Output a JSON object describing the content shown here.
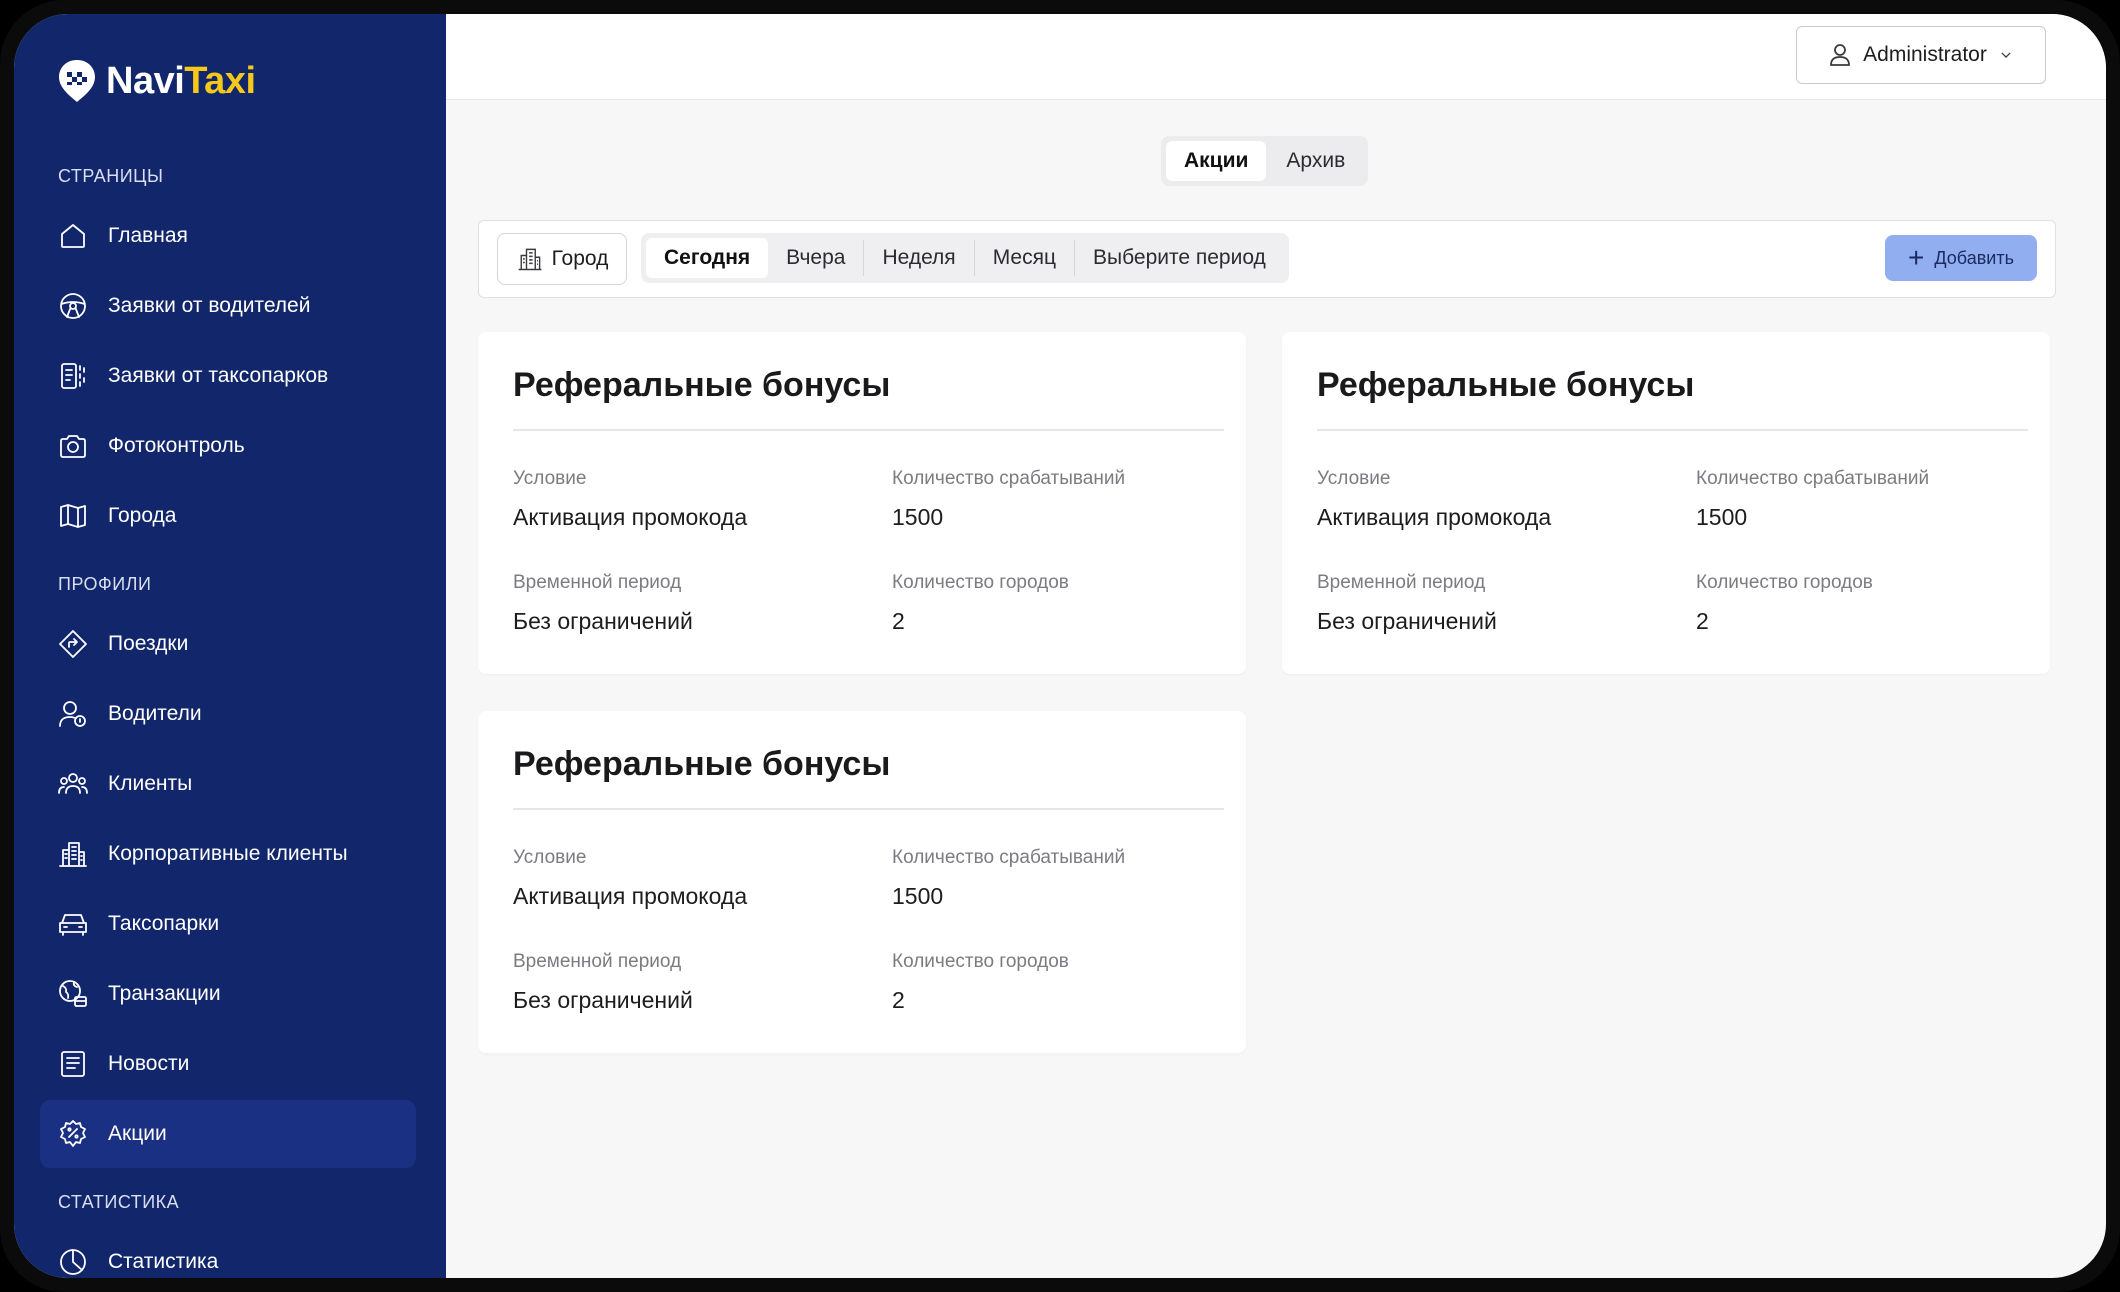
{
  "app": {
    "logo_part1": "Navi",
    "logo_part2": "Taxi"
  },
  "colors": {
    "sidebar_bg": "#12266b",
    "sidebar_active": "#1a3082",
    "logo_accent": "#f6c81a",
    "add_button": "#91aef0"
  },
  "sidebar": {
    "sections": [
      {
        "title": "Страницы",
        "items": [
          {
            "label": "Главная",
            "icon": "home-icon"
          },
          {
            "label": "Заявки от водителей",
            "icon": "steering-wheel-icon"
          },
          {
            "label": "Заявки от таксопарков",
            "icon": "documents-icon"
          },
          {
            "label": "Фотоконтроль",
            "icon": "camera-icon"
          },
          {
            "label": "Города",
            "icon": "map-icon"
          }
        ]
      },
      {
        "title": "Профили",
        "items": [
          {
            "label": "Поездки",
            "icon": "route-icon"
          },
          {
            "label": "Водители",
            "icon": "driver-icon"
          },
          {
            "label": "Клиенты",
            "icon": "users-icon"
          },
          {
            "label": "Корпоративные клиенты",
            "icon": "building-icon"
          },
          {
            "label": "Таксопарки",
            "icon": "car-icon"
          },
          {
            "label": "Транзакции",
            "icon": "transactions-icon"
          },
          {
            "label": "Новости",
            "icon": "news-icon"
          },
          {
            "label": "Акции",
            "icon": "promo-icon",
            "active": true
          }
        ]
      },
      {
        "title": "Статистика",
        "items": [
          {
            "label": "Статистика",
            "icon": "pie-chart-icon"
          }
        ]
      }
    ]
  },
  "header": {
    "user_label": "Administrator"
  },
  "tabs": [
    {
      "label": "Акции",
      "active": true
    },
    {
      "label": "Архив"
    }
  ],
  "filters": {
    "city_label": "Город",
    "periods": [
      {
        "label": "Сегодня",
        "active": true
      },
      {
        "label": "Вчера"
      },
      {
        "label": "Неделя"
      },
      {
        "label": "Месяц"
      },
      {
        "label": "Выберите период"
      }
    ],
    "add_label": "Добавить"
  },
  "cards": [
    {
      "title": "Реферальные бонусы",
      "condition_label": "Условие",
      "condition_value": "Активация промокода",
      "count_label": "Количество срабатываний",
      "count_value": "1500",
      "period_label": "Временной период",
      "period_value": "Без ограничений",
      "cities_label": "Количество городов",
      "cities_value": "2"
    },
    {
      "title": "Реферальные бонусы",
      "condition_label": "Условие",
      "condition_value": "Активация промокода",
      "count_label": "Количество срабатываний",
      "count_value": "1500",
      "period_label": "Временной период",
      "period_value": "Без ограничений",
      "cities_label": "Количество городов",
      "cities_value": "2"
    },
    {
      "title": "Реферальные бонусы",
      "condition_label": "Условие",
      "condition_value": "Активация промокода",
      "count_label": "Количество срабатываний",
      "count_value": "1500",
      "period_label": "Временной период",
      "period_value": "Без ограничений",
      "cities_label": "Количество городов",
      "cities_value": "2"
    }
  ]
}
